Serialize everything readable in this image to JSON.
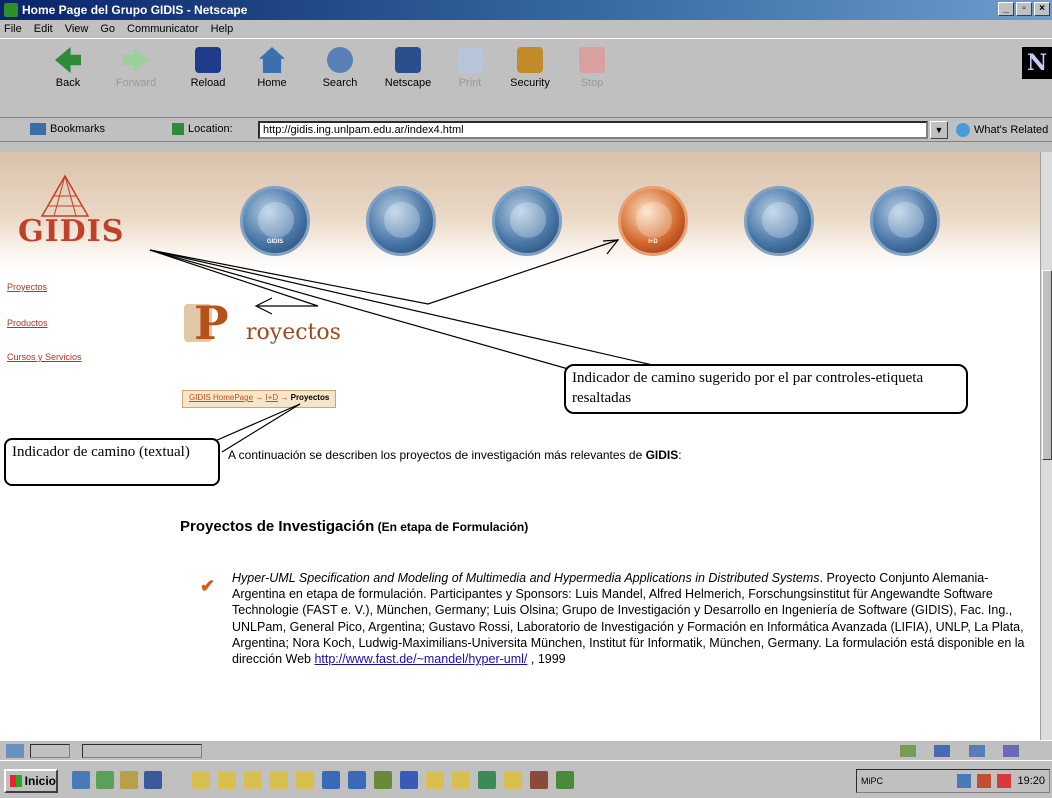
{
  "window": {
    "title": "Home Page del Grupo GIDIS - Netscape",
    "controls": [
      "_",
      "▫",
      "×"
    ]
  },
  "menu": [
    "File",
    "Edit",
    "View",
    "Go",
    "Communicator",
    "Help"
  ],
  "nav": {
    "back": "Back",
    "forward": "Forward",
    "reload": "Reload",
    "home": "Home",
    "search": "Search",
    "netscape": "Netscape",
    "print": "Print",
    "security": "Security",
    "stop": "Stop",
    "brand": "N"
  },
  "location": {
    "bookmarks": "Bookmarks",
    "label": "Location:",
    "url": "http://gidis.ing.unlpam.edu.ar/index4.html",
    "related": "What's Related"
  },
  "page": {
    "logo": "GIDIS",
    "circles": [
      "GIDIS",
      "",
      "",
      "I+D",
      "",
      ""
    ],
    "sidebar": [
      "Proyectos",
      "Productos",
      "Cursos y Servicios"
    ],
    "title_letter": "P",
    "title_rest": "royectos",
    "breadcrumb": {
      "home": "GIDIS HomePage",
      "arrow1": " → ",
      "mid": "I+D",
      "arrow2": " → ",
      "current": "Proyectos"
    },
    "intro_pre": "A continuación se describen los proyectos de investigación más relevantes de ",
    "intro_bold": "GIDIS",
    "intro_post": ":",
    "section_title": "Proyectos de Investigación",
    "section_sub": " (En etapa de Formulación)",
    "project_title": "Hyper-UML Specification and Modeling of Multimedia and Hypermedia Applications in Distributed Systems",
    "project_body": ". Proyecto Conjunto Alemania-Argentina en etapa de formulación. Participantes y Sponsors: Luis Mandel, Alfred Helmerich, Forschungsinstitut für Angewandte Software Technologie (FAST e. V.), München, Germany; Luis Olsina; Grupo de Investigación y Desarrollo en Ingeniería de Software (GIDIS), Fac. Ing., UNLPam, General Pico, Argentina; Gustavo Rossi, Laboratorio de Investigación y Formación en Informática Avanzada (LIFIA), UNLP, La Plata, Argentina; Nora Koch, Ludwig-Maximilians-Universita München, Institut für Informatik, München, Germany.  La formulación está  disponible en la dirección Web ",
    "project_link": "http://www.fast.de/~mandel/hyper-uml/",
    "project_year": " , 1999"
  },
  "callouts": {
    "path_suggested": "Indicador  de camino sugerido por el par controles-etiqueta  resaltadas",
    "path_textual": "Indicador  de camino (textual)"
  },
  "taskbar": {
    "start": "Inicio",
    "tray_label": "MiPC",
    "clock": "19:20"
  },
  "colors": {
    "title_bar": "#0a246a",
    "logo": "#c1402a",
    "accent": "#d46a2e",
    "link": "#1a0dab"
  }
}
